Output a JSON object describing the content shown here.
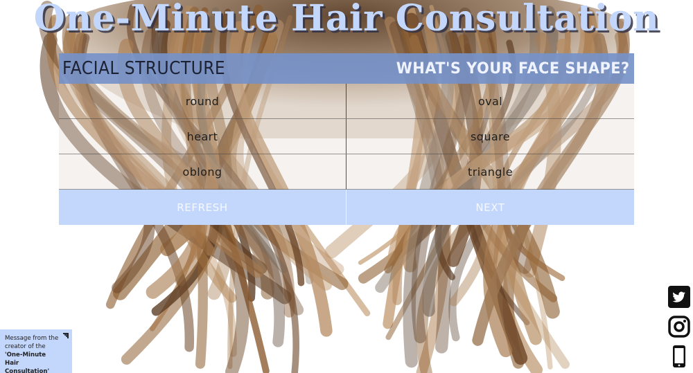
{
  "page": {
    "title": "One-Minute Hair Consultation"
  },
  "quiz": {
    "section_title": "FACIAL STRUCTURE",
    "question": "WHAT'S YOUR FACE SHAPE?",
    "options": [
      "round",
      "oval",
      "heart",
      "square",
      "oblong",
      "triangle"
    ],
    "refresh_label": "REFRESH",
    "next_label": "NEXT"
  },
  "message": {
    "prefix": "Message from the creator of the ",
    "app_name": "'One-Minute Hair Consultation'"
  },
  "social": {
    "icons": [
      "twitter-icon",
      "instagram-icon",
      "phone-icon"
    ]
  },
  "colors": {
    "accent_light": "#c3d6fb",
    "header_bar": "#7693c9",
    "hair_brown": "#8a5a2b"
  }
}
